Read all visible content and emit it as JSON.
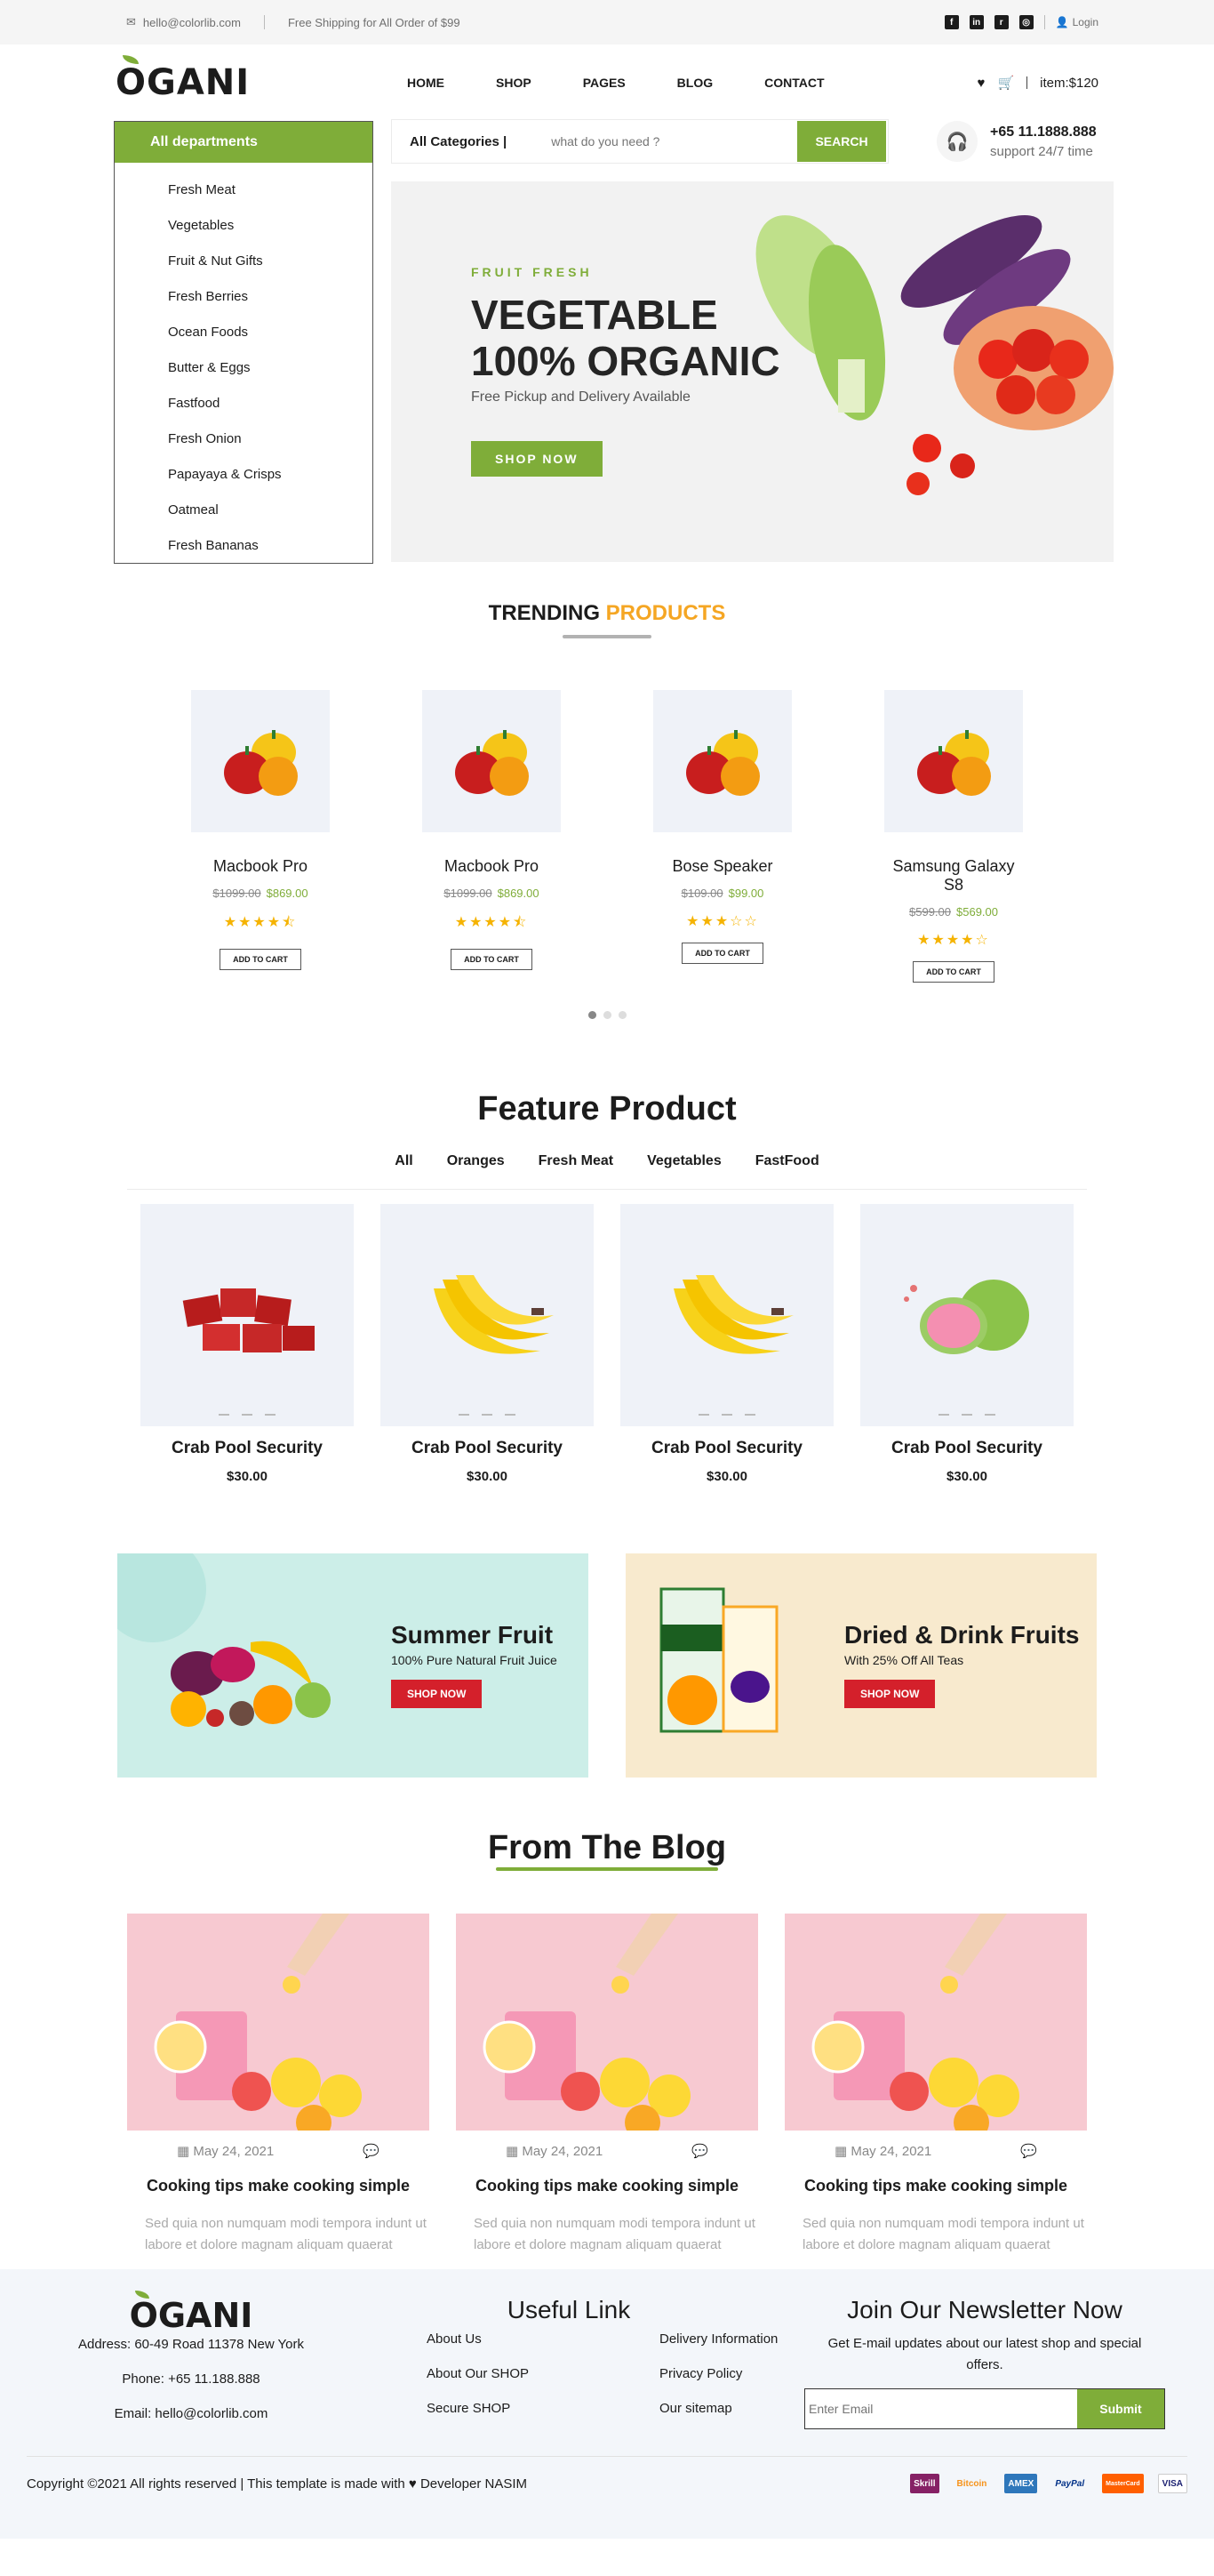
{
  "topbar": {
    "email": "hello@colorlib.com",
    "shipping": "Free Shipping for All Order of $99",
    "login": "Login"
  },
  "header": {
    "logo": "OGANI",
    "nav": [
      "HOME",
      "SHOP",
      "PAGES",
      "BLOG",
      "CONTACT"
    ],
    "cart_text": "item:$120"
  },
  "departments": {
    "title": "All departments",
    "items": [
      "Fresh Meat",
      "Vegetables",
      "Fruit & Nut Gifts",
      "Fresh Berries",
      "Ocean Foods",
      "Butter & Eggs",
      "Fastfood",
      "Fresh Onion",
      "Papayaya & Crisps",
      "Oatmeal",
      "Fresh Bananas"
    ]
  },
  "search": {
    "category": "All Categories |",
    "placeholder": "what do you need ?",
    "button": "SEARCH"
  },
  "contact": {
    "phone": "+65 11.1888.888",
    "support": "support 24/7 time"
  },
  "banner": {
    "kicker": "FRUIT FRESH",
    "title_line1": "VEGETABLE",
    "title_line2": "100% ORGANIC",
    "subtitle": "Free Pickup and Delivery Available",
    "button": "SHOP NOW"
  },
  "trending": {
    "title_a": "TRENDING ",
    "title_b": "PRODUCTS",
    "products": [
      {
        "name": "Macbook Pro",
        "old": "$1099.00",
        "new": "$869.00",
        "stars": "★★★★⯪",
        "cart": "ADD TO CART"
      },
      {
        "name": "Macbook Pro",
        "old": "$1099.00",
        "new": "$869.00",
        "stars": "★★★★⯪",
        "cart": "ADD TO CART"
      },
      {
        "name": "Bose Speaker",
        "old": "$109.00",
        "new": "$99.00",
        "stars": "★★★☆☆",
        "cart": "ADD TO CART"
      },
      {
        "name": "Samsung Galaxy S8",
        "old": "$599.00",
        "new": "$569.00",
        "stars": "★★★★☆",
        "cart": "ADD TO CART"
      }
    ]
  },
  "feature": {
    "title": "Feature Product",
    "tabs": [
      "All",
      "Oranges",
      "Fresh Meat",
      "Vegetables",
      "FastFood"
    ],
    "items": [
      {
        "name": "Crab Pool Security",
        "price": "$30.00"
      },
      {
        "name": "Crab Pool Security",
        "price": "$30.00"
      },
      {
        "name": "Crab Pool Security",
        "price": "$30.00"
      },
      {
        "name": "Crab Pool Security",
        "price": "$30.00"
      }
    ]
  },
  "promos": [
    {
      "title": "Summer Fruit",
      "subtitle": "100% Pure Natural Fruit Juice",
      "button": "SHOP NOW"
    },
    {
      "title": "Dried & Drink Fruits",
      "subtitle": "With 25% Off All Teas",
      "button": "SHOP NOW"
    }
  ],
  "blog": {
    "title": "From The Blog",
    "posts": [
      {
        "date": "May 24, 2021",
        "title": "Cooking tips make cooking simple",
        "text": "Sed quia non numquam modi tempora indunt ut labore et dolore magnam aliquam quaerat"
      },
      {
        "date": "May 24, 2021",
        "title": "Cooking tips make cooking simple",
        "text": "Sed quia non numquam modi tempora indunt ut labore et dolore magnam aliquam quaerat"
      },
      {
        "date": "May 24, 2021",
        "title": "Cooking tips make cooking simple",
        "text": "Sed quia non numquam modi tempora indunt ut labore et dolore magnam aliquam quaerat"
      }
    ]
  },
  "footer": {
    "logo": "OGANI",
    "address": "Address: 60-49 Road 11378 New York",
    "phone": "Phone: +65 11.188.888",
    "email": "Email: hello@colorlib.com",
    "links_title": "Useful Link",
    "links": [
      "About Us",
      "Delivery Information",
      "About Our SHOP",
      "Privacy Policy",
      "Secure SHOP",
      "Our sitemap"
    ],
    "newsletter_title": "Join Our Newsletter Now",
    "newsletter_text": "Get E-mail updates about our latest shop and special offers.",
    "newsletter_placeholder": "Enter Email",
    "newsletter_button": "Submit",
    "copyright": "Copyright ©2021 All rights reserved | This template is made with",
    "developer": "Developer NASIM",
    "payments": [
      "Skrill",
      "Bitcoin",
      "AMEX",
      "PayPal",
      "MasterCard",
      "VISA"
    ]
  },
  "colors": {
    "brand": "#7fad39",
    "accent": "#f5a623",
    "promo_red": "#d4202b"
  }
}
